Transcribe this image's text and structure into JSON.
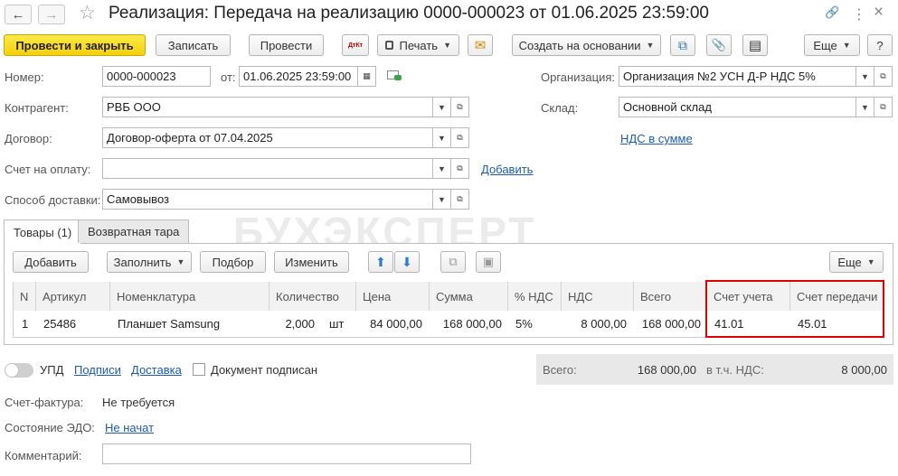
{
  "window": {
    "title": "Реализация: Передача на реализацию 0000-000023 от 01.06.2025 23:59:00",
    "back_glyph": "←",
    "forward_glyph": "→",
    "star_glyph": "☆",
    "link_glyph": "🔗",
    "more_glyph": "⋮",
    "close_glyph": "×"
  },
  "toolbar": {
    "post_close": "Провести и закрыть",
    "save": "Записать",
    "post": "Провести",
    "dtkt": "ДтКт",
    "print": "Печать",
    "email_glyph": "✉",
    "create_based": "Создать на основании",
    "structure_glyph": "⧉",
    "attach_glyph": "📎",
    "report_glyph": "▤",
    "more": "Еще",
    "help": "?"
  },
  "form": {
    "number_label": "Номер:",
    "number": "0000-000023",
    "from_label": "от:",
    "date": "01.06.2025 23:59:00",
    "org_label": "Организация:",
    "org": "Организация №2 УСН Д-Р НДС 5%",
    "counterparty_label": "Контрагент:",
    "counterparty": "РВБ ООО",
    "warehouse_label": "Склад:",
    "warehouse": "Основной склад",
    "contract_label": "Договор:",
    "contract": "Договор-оферта от 07.04.2025",
    "vat_link": "НДС в сумме",
    "invoice_label": "Счет на оплату:",
    "invoice": "",
    "add_link": "Добавить",
    "delivery_label": "Способ доставки:",
    "delivery": "Самовывоз"
  },
  "tabs": [
    {
      "label": "Товары (1)"
    },
    {
      "label": "Возвратная тара"
    }
  ],
  "watermark": "БУХЭКСПЕРТ",
  "table_toolbar": {
    "add": "Добавить",
    "fill": "Заполнить",
    "select": "Подбор",
    "change": "Изменить",
    "up_glyph": "⬆",
    "down_glyph": "⬇",
    "more": "Еще"
  },
  "table": {
    "columns": [
      "N",
      "Артикул",
      "Номенклатура",
      "Количество",
      "Цена",
      "Сумма",
      "% НДС",
      "НДС",
      "Всего",
      "Счет учета",
      "Счет передачи"
    ],
    "rows": [
      {
        "n": "1",
        "article": "25486",
        "name": "Планшет Samsung",
        "qty": "2,000",
        "unit": "шт",
        "price": "84 000,00",
        "sum": "168 000,00",
        "vat_rate": "5%",
        "vat": "8 000,00",
        "total": "168 000,00",
        "account": "41.01",
        "transfer_account": "45.01"
      }
    ]
  },
  "footer": {
    "upd_label": "УПД",
    "signatures_link": "Подписи",
    "delivery_link": "Доставка",
    "signed_label": "Документ подписан",
    "total_label": "Всего:",
    "total": "168 000,00",
    "vat_incl_label": "в т.ч. НДС:",
    "vat_total": "8 000,00",
    "invoice_label": "Счет-фактура:",
    "invoice_value": "Не требуется",
    "edo_label": "Состояние ЭДО:",
    "edo_value": "Не начат",
    "comment_label": "Комментарий:",
    "comment": ""
  },
  "colors": {
    "primary_button": "#f5d00a",
    "link": "#1d5ab0",
    "highlight_border": "#e00000",
    "totals_bg": "#e8e8e8"
  }
}
